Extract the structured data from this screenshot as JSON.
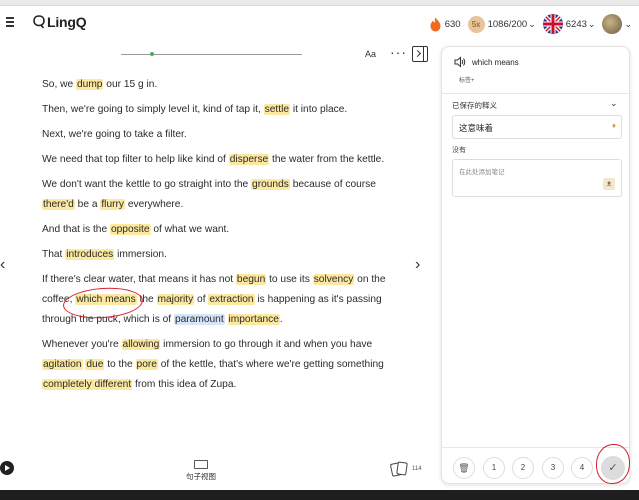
{
  "app": {
    "name": "LingQ"
  },
  "header": {
    "streak": "630",
    "coin_multiplier": "5x",
    "daily_progress": "1086/200",
    "known_words": "6243",
    "flag_icon": "uk-flag-icon",
    "avatar_icon": "user-avatar-icon"
  },
  "reader": {
    "font_button": "Aa",
    "more_button": "···",
    "progress_fraction": 0.17,
    "sentence_view_label": "句子视图",
    "cards_count": "114"
  },
  "lesson": {
    "paragraphs": [
      [
        {
          "t": "So, we "
        },
        {
          "t": "dump",
          "h": "yellow"
        },
        {
          "t": " our 15 g in."
        }
      ],
      [
        {
          "t": "Then, we're going to simply level it, kind of tap it, "
        },
        {
          "t": "settle",
          "h": "yellow"
        },
        {
          "t": " it into place."
        }
      ],
      [
        {
          "t": "Next, we're going to take a filter."
        }
      ],
      [
        {
          "t": "We need that top filter to help like kind of "
        },
        {
          "t": "disperse",
          "h": "yellow"
        },
        {
          "t": " the water from the kettle."
        }
      ],
      [
        {
          "t": "We don't want the kettle to go straight into the "
        },
        {
          "t": "grounds",
          "h": "yellow"
        },
        {
          "t": " because of course "
        },
        {
          "t": "there'd",
          "h": "yellow"
        },
        {
          "t": " be a "
        },
        {
          "t": "flurry",
          "h": "yellow"
        },
        {
          "t": " everywhere."
        }
      ],
      [
        {
          "t": "And that is the "
        },
        {
          "t": "opposite",
          "h": "yellow"
        },
        {
          "t": " of what we want."
        }
      ],
      [
        {
          "t": "That "
        },
        {
          "t": "introduces",
          "h": "yellow"
        },
        {
          "t": " immersion."
        }
      ],
      [
        {
          "t": "If there's clear water, that means it has not "
        },
        {
          "t": "begun",
          "h": "yellow"
        },
        {
          "t": " to use its "
        },
        {
          "t": "solvency",
          "h": "yellow"
        },
        {
          "t": " on the coffee, "
        },
        {
          "t": "which means",
          "h": "yellow",
          "circled": true
        },
        {
          "t": " the "
        },
        {
          "t": "majority",
          "h": "yellow"
        },
        {
          "t": " of "
        },
        {
          "t": "extraction",
          "h": "yellow"
        },
        {
          "t": " is happening as it's passing through the puck, which is of "
        },
        {
          "t": "paramount",
          "h": "blue"
        },
        {
          "t": " "
        },
        {
          "t": "importance",
          "h": "yellow"
        },
        {
          "t": "."
        }
      ],
      [
        {
          "t": "Whenever you're "
        },
        {
          "t": "allowing",
          "h": "yellow"
        },
        {
          "t": " immersion to go through it and when you have "
        },
        {
          "t": "agitation",
          "h": "yellow"
        },
        {
          "t": " "
        },
        {
          "t": "due",
          "h": "yellow"
        },
        {
          "t": " to the "
        },
        {
          "t": "pore",
          "h": "yellow"
        },
        {
          "t": " of the kettle, that's where we're getting something "
        },
        {
          "t": "completely different",
          "h": "yellow"
        },
        {
          "t": " from this idea of Zupa."
        }
      ]
    ]
  },
  "panel": {
    "term": "which means",
    "tag_button": "标签+",
    "saved_meanings_label": "已保存的释义",
    "meaning": "这意味着",
    "none_label": "没有",
    "notes_placeholder": "在此处添加笔记",
    "levels": [
      "1",
      "2",
      "3",
      "4"
    ],
    "known_check": "✓"
  },
  "colors": {
    "highlight_yellow": "#fce89e",
    "highlight_blue": "#d5e6f8",
    "annotation_red": "#d61f2b"
  }
}
